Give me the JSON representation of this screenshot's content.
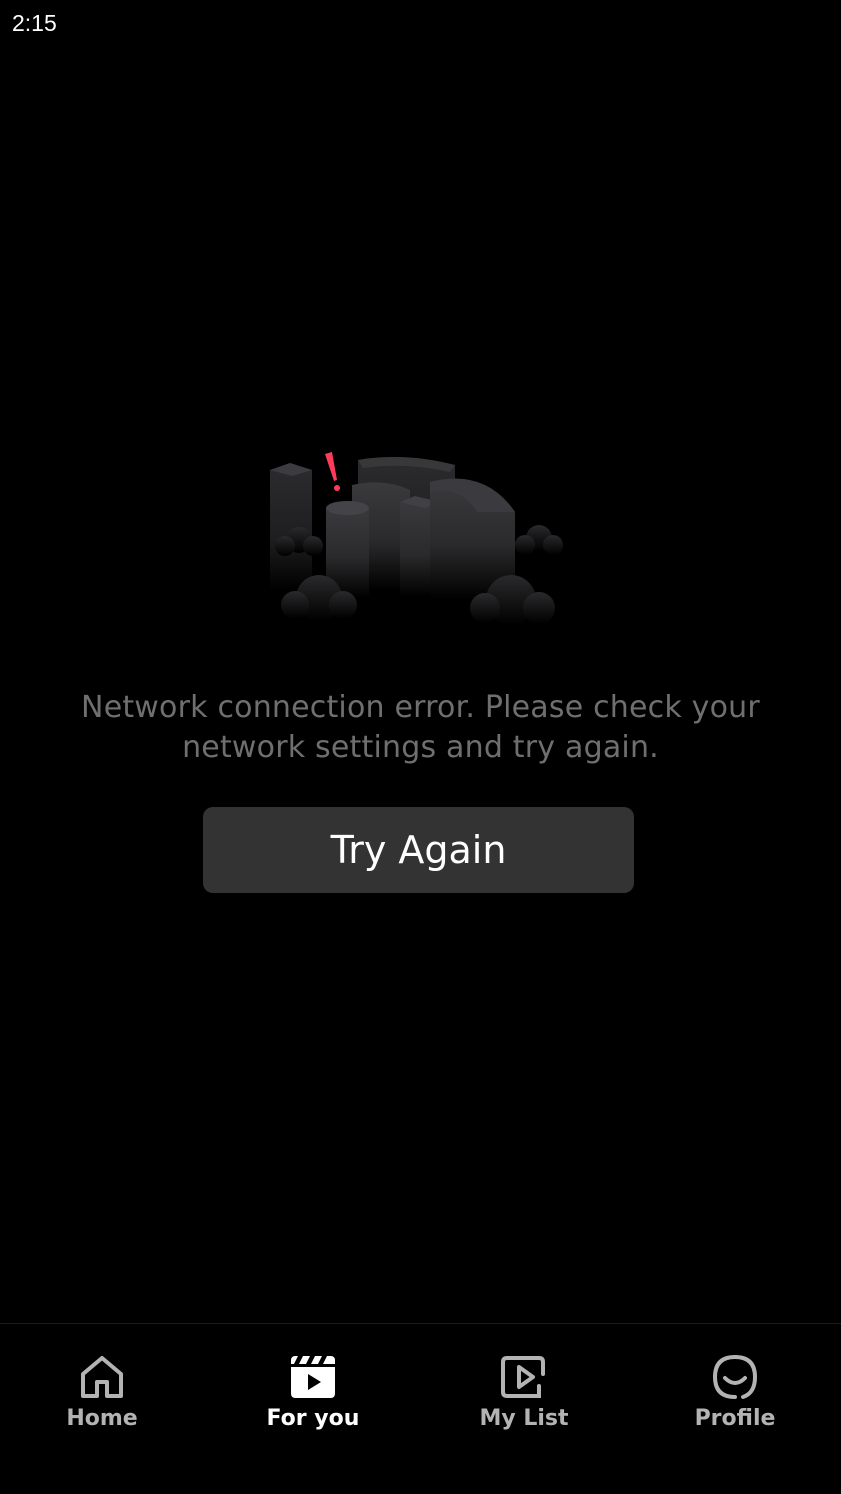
{
  "status_bar": {
    "time": "2:15"
  },
  "error": {
    "illustration_icon": "network-error-city-icon",
    "message": "Network connection error. Please check your network settings and try again.",
    "retry_label": "Try Again"
  },
  "bottom_nav": {
    "items": [
      {
        "label": "Home",
        "icon": "home-icon",
        "active": false
      },
      {
        "label": "For you",
        "icon": "clapperboard-play-icon",
        "active": true
      },
      {
        "label": "My List",
        "icon": "play-list-icon",
        "active": false
      },
      {
        "label": "Profile",
        "icon": "smiley-face-icon",
        "active": false
      }
    ]
  },
  "colors": {
    "background": "#000000",
    "message_text": "#6f6f6f",
    "button_bg": "#333333",
    "alert_accent": "#ff3b5c",
    "nav_inactive": "#b3b3b3",
    "nav_active": "#ffffff"
  }
}
